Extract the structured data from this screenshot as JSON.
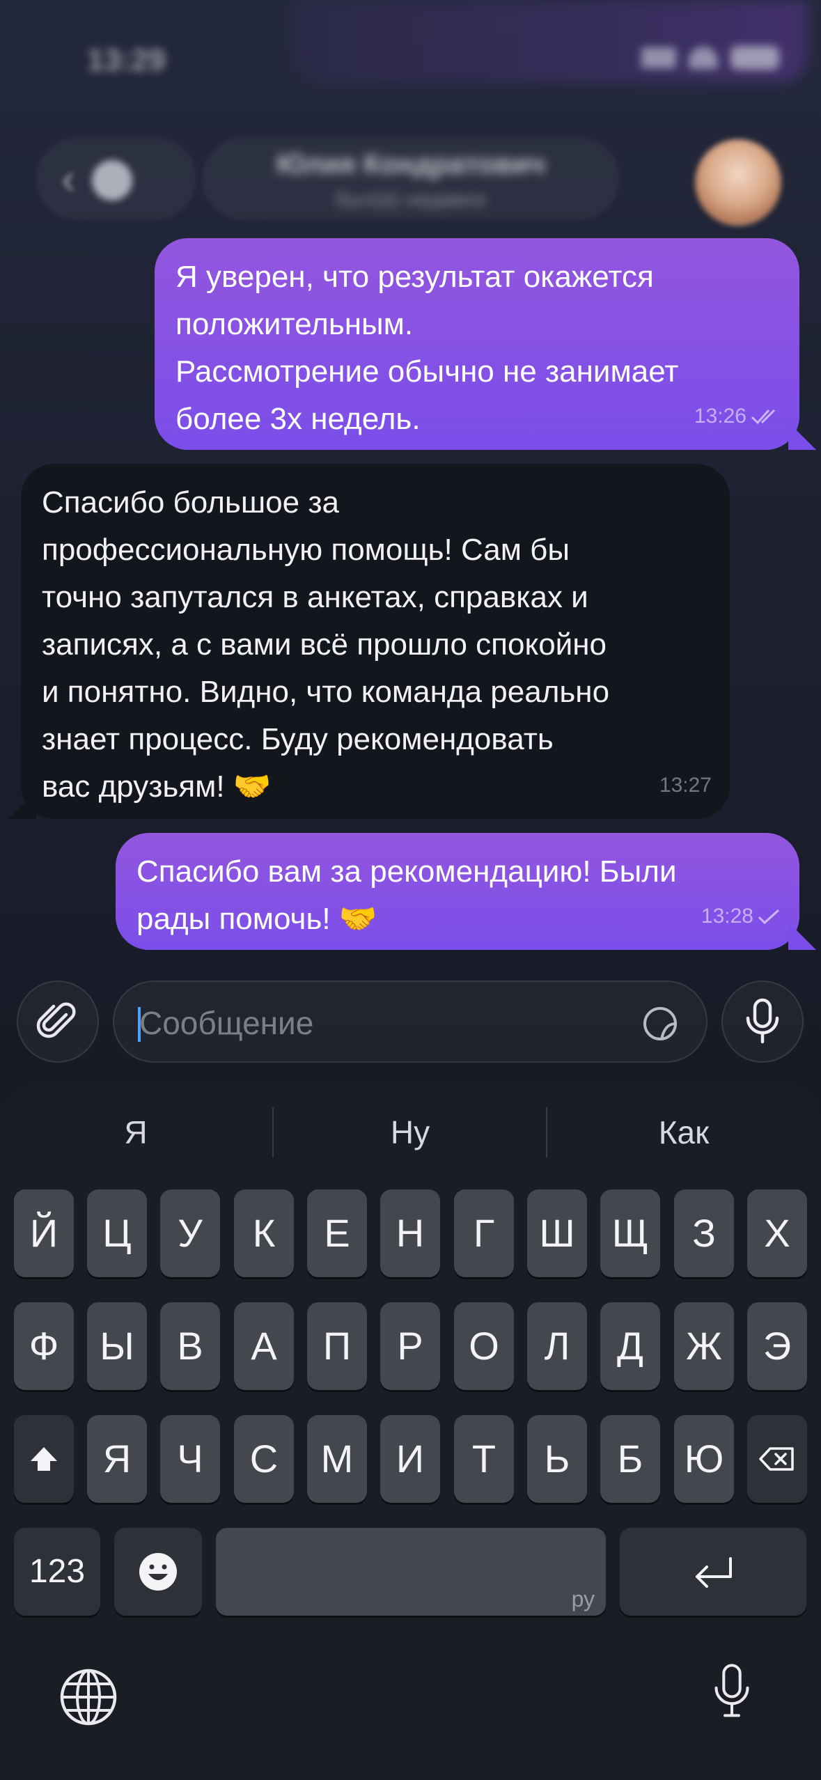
{
  "status_bar": {
    "time": "13:29"
  },
  "header": {
    "contact_name": "Юлия Кондратович",
    "contact_status": "был(а) недавно"
  },
  "messages": [
    {
      "direction": "out",
      "text": "Я уверен, что результат окажется\nположительным.\nРассмотрение обычно не занимает\nболее 3х недель.",
      "time": "13:26",
      "status": "read"
    },
    {
      "direction": "in",
      "text": "Спасибо большое за\nпрофессиональную помощь! Сам бы\nточно запутался в анкетах, справках и\nзаписях, а с вами всё прошло спокойно\nи понятно. Видно, что команда реально\nзнает процесс. Буду рекомендовать\nвас друзьям!",
      "emoji": "🤝",
      "time": "13:27"
    },
    {
      "direction": "out",
      "text": "Спасибо вам за рекомендацию! Были\nрады помочь!",
      "emoji": "🤝",
      "time": "13:28",
      "status": "sent"
    }
  ],
  "composer": {
    "placeholder": "Сообщение"
  },
  "keyboard": {
    "suggestions": [
      "Я",
      "Ну",
      "Как"
    ],
    "row1": [
      "Й",
      "Ц",
      "У",
      "К",
      "Е",
      "Н",
      "Г",
      "Ш",
      "Щ",
      "З",
      "Х"
    ],
    "row2": [
      "Ф",
      "Ы",
      "В",
      "А",
      "П",
      "Р",
      "О",
      "Л",
      "Д",
      "Ж",
      "Э"
    ],
    "row3": [
      "Я",
      "Ч",
      "С",
      "М",
      "И",
      "Т",
      "Ь",
      "Б",
      "Ю"
    ],
    "numbers_key": "123",
    "space_lang": "ру"
  },
  "colors": {
    "outgoing_bubble": "#8a52e4",
    "incoming_bubble": "#14161d",
    "key": "#45474f",
    "keyboard_bg": "#1b1d24"
  }
}
